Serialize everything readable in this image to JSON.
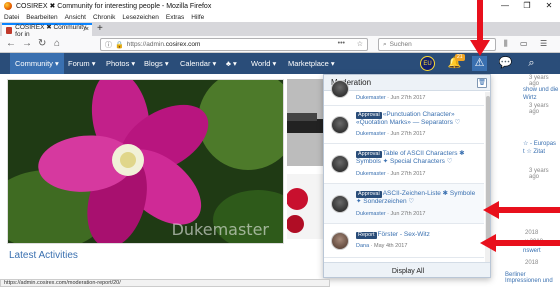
{
  "window": {
    "title": "COSIREX ✖ Community for interesting people - Mozilla Firefox",
    "controls": [
      "—",
      "❐",
      "✕"
    ]
  },
  "menubar": [
    "Datei",
    "Bearbeiten",
    "Ansicht",
    "Chronik",
    "Lesezeichen",
    "Extras",
    "Hilfe"
  ],
  "tab": {
    "label": "COSIREX ✖ Community for in",
    "close": "×",
    "new": "+"
  },
  "navbar": {
    "back": "←",
    "forward": "→",
    "reload": "↻",
    "home": "⌂",
    "url_scheme": "https://admin.",
    "url_host": "cosirex.com",
    "page_actions": "•••",
    "bookmark_star": "☆",
    "search_placeholder": "Suchen",
    "tools": [
      "⫼",
      "▭",
      "☰"
    ]
  },
  "sitenav": {
    "items": [
      "Community ▾",
      "Forum ▾",
      "Photos ▾",
      "Blogs ▾",
      "Calendar ▾",
      "♣ ▾",
      "World ▾",
      "Marketplace ▾"
    ],
    "globe_label": "EU",
    "notification_badge": "21"
  },
  "content": {
    "watermark": "Dukemaster",
    "latest_heading": "Latest Activities",
    "right_column": [
      "3 years ago",
      "show und die",
      "Wirtz",
      "3 years ago",
      "☆ - Europas",
      "t ☆ Zitat",
      "3 years ago",
      "2018",
      "y 2018",
      "nswert",
      "2018",
      "Berliner Impressionen und"
    ]
  },
  "moderation": {
    "title": "Moderation",
    "trash_icon": "🗑",
    "items": [
      {
        "tag": "",
        "title": "",
        "author": "Dukemaster",
        "date": "Jun 27th 2017"
      },
      {
        "tag": "Approval",
        "title": "«Punctuation Character» «Quotation Marks» — Separators ♡",
        "author": "Dukemaster",
        "date": "Jun 27th 2017"
      },
      {
        "tag": "Approval",
        "title": "Table of ASCII Characters ✱ Symbols ✦ Special Characters ♡",
        "author": "Dukemaster",
        "date": "Jun 27th 2017"
      },
      {
        "tag": "Approval",
        "title": "ASCII-Zeichen-Liste ✱ Symbole ✦ Sonderzeichen ♡",
        "author": "Dukemaster",
        "date": "Jun 27th 2017"
      },
      {
        "tag": "Report",
        "title": "Förster - Sex-Witz",
        "author": "Dana",
        "date": "May 4th 2017"
      }
    ],
    "footer": "Display All"
  },
  "statusbar": "https://admin.cosirex.com/moderation-report/20/",
  "colors": {
    "nav_bg": "#2a4d79",
    "accent": "#3a70b0",
    "arrow": "#e8101c"
  }
}
